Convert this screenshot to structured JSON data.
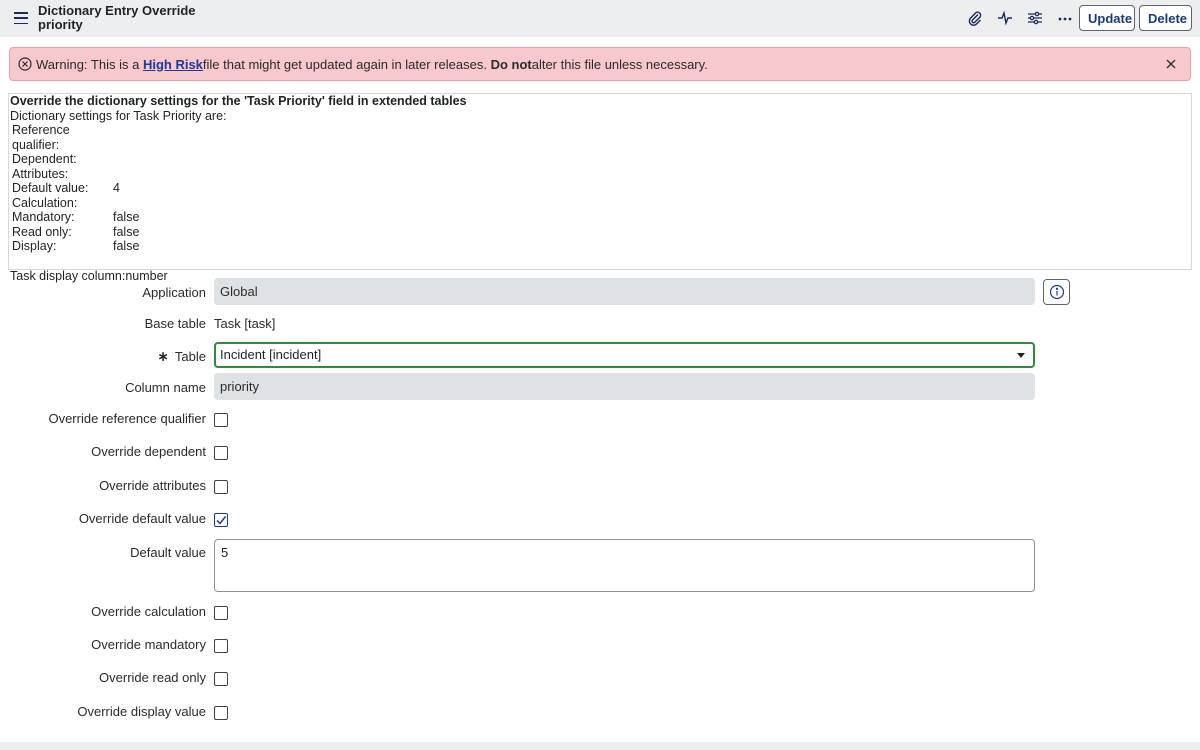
{
  "header": {
    "title_line1": "Dictionary Entry Override",
    "title_line2": "priority",
    "update_label": "Update",
    "delete_label": "Delete",
    "icons": [
      "paperclip-icon",
      "activity-icon",
      "sliders-icon",
      "more-icon"
    ]
  },
  "warning": {
    "prefix": "Warning: This is a ",
    "link": "High Risk",
    "middle": " file that might get updated again in later releases. ",
    "bold": "Do not",
    "suffix": " alter this file unless necessary."
  },
  "info": {
    "title": "Override the dictionary settings for the 'Task Priority' field in extended tables",
    "subtitle": "Dictionary settings for Task Priority are:",
    "rows": [
      {
        "key": "Reference qualifier:",
        "value": ""
      },
      {
        "key": "Dependent:",
        "value": ""
      },
      {
        "key": "Attributes:",
        "value": ""
      },
      {
        "key": "Default value:",
        "value": "4"
      },
      {
        "key": "Calculation:",
        "value": ""
      },
      {
        "key": "Mandatory:",
        "value": "false"
      },
      {
        "key": "Read only:",
        "value": "false"
      },
      {
        "key": "Display:",
        "value": "false"
      }
    ],
    "footer": "Task display column:number"
  },
  "form": {
    "application_label": "Application",
    "application_value": "Global",
    "base_table_label": "Base table",
    "base_table_value": "Task [task]",
    "table_label": "Table",
    "table_value": "Incident [incident]",
    "column_name_label": "Column name",
    "column_name_value": "priority",
    "override_reference_qualifier_label": "Override reference qualifier",
    "override_dependent_label": "Override dependent",
    "override_attributes_label": "Override attributes",
    "override_default_value_label": "Override default value",
    "default_value_label": "Default value",
    "default_value_value": "5",
    "override_calculation_label": "Override calculation",
    "override_mandatory_label": "Override mandatory",
    "override_read_only_label": "Override read only",
    "override_display_value_label": "Override display value",
    "checkboxes": {
      "override_reference_qualifier": false,
      "override_dependent": false,
      "override_attributes": false,
      "override_default_value": true,
      "override_calculation": false,
      "override_mandatory": false,
      "override_read_only": false,
      "override_display_value": false
    }
  },
  "colors": {
    "header_bg": "#eceef0",
    "warning_bg": "#f7c8cc",
    "link": "#1b3a9a",
    "focus_border": "#2e8b3a"
  }
}
